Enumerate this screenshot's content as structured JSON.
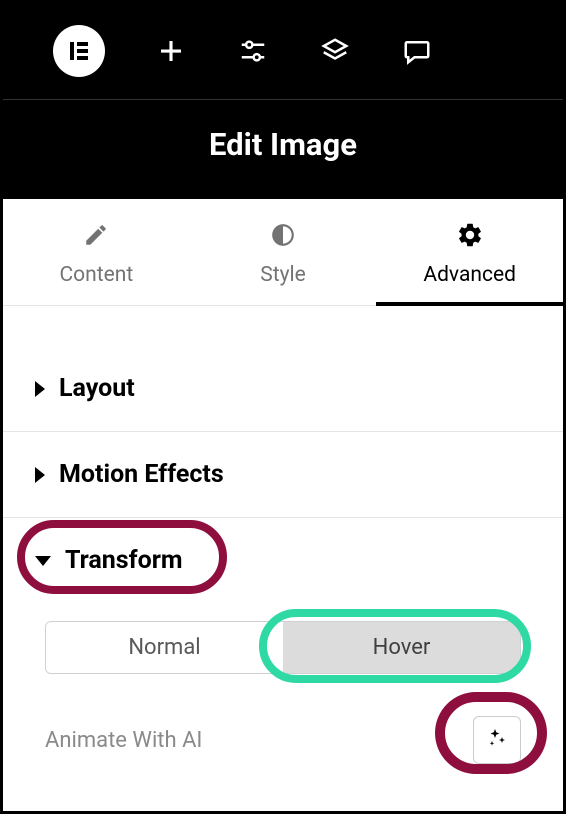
{
  "header": {
    "title": "Edit Image"
  },
  "tabs": {
    "content": "Content",
    "style": "Style",
    "advanced": "Advanced",
    "active": "advanced"
  },
  "sections": {
    "layout": "Layout",
    "motion_effects": "Motion Effects",
    "transform": "Transform"
  },
  "transform_toggle": {
    "normal": "Normal",
    "hover": "Hover",
    "selected": "hover"
  },
  "animate": {
    "label": "Animate With AI"
  },
  "highlights": {
    "transform_color": "#8e0f3e",
    "hover_color": "#2fd9a4",
    "ai_color": "#8e0f3e"
  }
}
